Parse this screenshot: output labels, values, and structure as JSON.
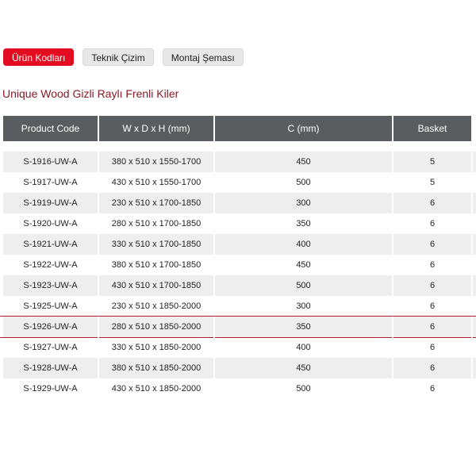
{
  "tabs": [
    {
      "label": "Ürün Kodları",
      "active": true
    },
    {
      "label": "Teknik Çizim",
      "active": false
    },
    {
      "label": "Montaj Şeması",
      "active": false
    }
  ],
  "title": "Unique Wood Gizli Raylı Frenli Kiler",
  "table": {
    "headers": [
      "Product Code",
      "W x D x H (mm)",
      "C (mm)",
      "Basket"
    ],
    "rows": [
      [
        "S-1916-UW-A",
        "380 x 510 x 1550-1700",
        "450",
        "5"
      ],
      [
        "S-1917-UW-A",
        "430 x 510 x 1550-1700",
        "500",
        "5"
      ],
      [
        "S-1919-UW-A",
        "230 x 510 x 1700-1850",
        "300",
        "6"
      ],
      [
        "S-1920-UW-A",
        "280 x 510 x 1700-1850",
        "350",
        "6"
      ],
      [
        "S-1921-UW-A",
        "330 x 510 x 1700-1850",
        "400",
        "6"
      ],
      [
        "S-1922-UW-A",
        "380 x 510 x 1700-1850",
        "450",
        "6"
      ],
      [
        "S-1923-UW-A",
        "430 x 510 x 1700-1850",
        "500",
        "6"
      ],
      [
        "S-1925-UW-A",
        "230 x 510 x 1850-2000",
        "300",
        "6"
      ],
      [
        "S-1926-UW-A",
        "280 x 510 x 1850-2000",
        "350",
        "6"
      ],
      [
        "S-1927-UW-A",
        "330 x 510 x 1850-2000",
        "400",
        "6"
      ],
      [
        "S-1928-UW-A",
        "380 x 510 x 1850-2000",
        "450",
        "6"
      ],
      [
        "S-1929-UW-A",
        "430 x 510 x 1850-2000",
        "500",
        "6"
      ]
    ],
    "highlighted_row": 8
  },
  "colors": {
    "active_tab": "#e30c20",
    "title": "#8a1a25",
    "header_bg": "#5a5d60",
    "row_shade": "#eeeeee",
    "highlight_line": "#b01c2a"
  }
}
